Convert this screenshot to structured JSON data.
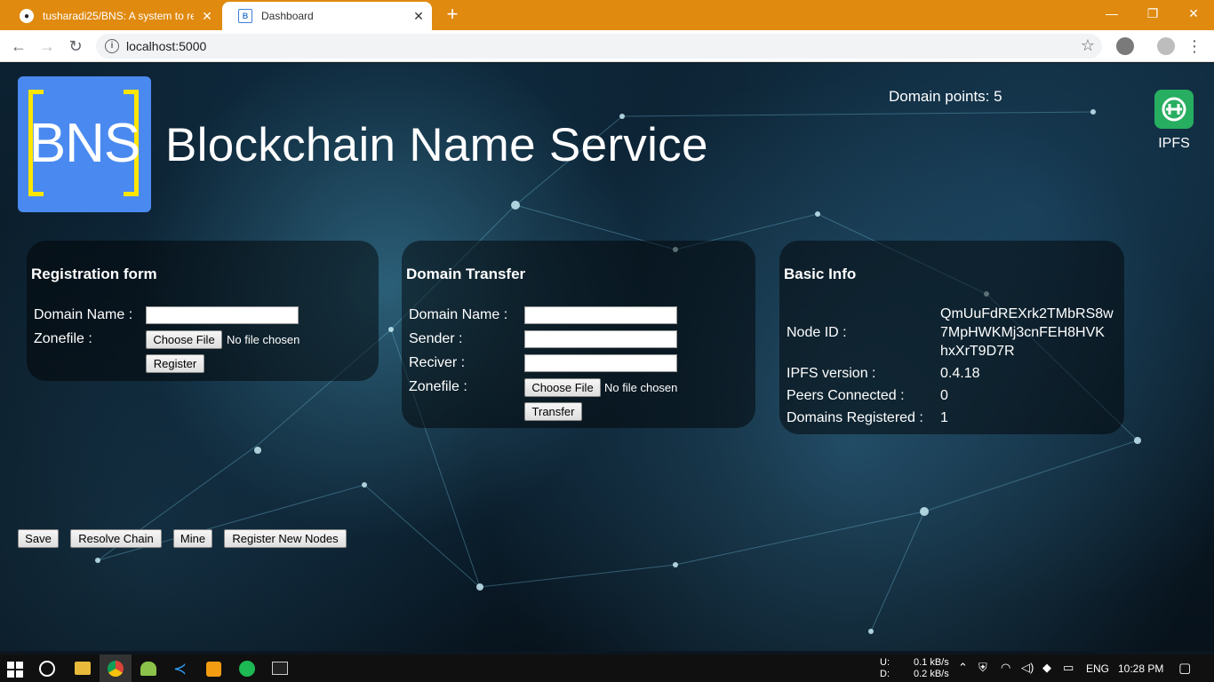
{
  "browser": {
    "tabs": [
      {
        "title": "tusharadi25/BNS: A system to re",
        "active": false
      },
      {
        "title": "Dashboard",
        "active": true
      }
    ],
    "new_tab": "+",
    "url": "localhost:5000",
    "window_controls": {
      "minimize": "—",
      "maximize": "❐",
      "close": "✕"
    }
  },
  "header": {
    "logo_text": "BNS",
    "title": "Blockchain Name Service",
    "domain_points_label": "Domain points:",
    "domain_points_value": "5",
    "ipfs_label": "IPFS"
  },
  "registration": {
    "heading": "Registration form",
    "domain_label": "Domain Name :",
    "domain_value": "",
    "zonefile_label": "Zonefile :",
    "choose_file": "Choose File",
    "no_file": "No file chosen",
    "submit": "Register"
  },
  "transfer": {
    "heading": "Domain Transfer",
    "domain_label": "Domain Name :",
    "sender_label": "Sender :",
    "receiver_label": "Reciver :",
    "zonefile_label": "Zonefile :",
    "choose_file": "Choose File",
    "no_file": "No file chosen",
    "submit": "Transfer"
  },
  "basic_info": {
    "heading": "Basic Info",
    "node_id_label": "Node ID :",
    "node_id_lines": [
      "QmUuFdREXrk2TMbRS8w",
      "7MpHWKMj3cnFEH8HVK",
      "hxXrT9D7R"
    ],
    "ipfs_version_label": "IPFS version :",
    "ipfs_version": "0.4.18",
    "peers_label": "Peers Connected :",
    "peers": "0",
    "domains_label": "Domains Registered :",
    "domains": "1"
  },
  "actions": {
    "save": "Save",
    "resolve": "Resolve Chain",
    "mine": "Mine",
    "register_nodes": "Register New Nodes"
  },
  "taskbar": {
    "upload_label": "U:",
    "upload_rate": "0.1 kB/s",
    "download_label": "D:",
    "download_rate": "0.2 kB/s",
    "language": "ENG",
    "time": "10:28 PM"
  },
  "colors": {
    "titlebar": "#e08a10",
    "logo_bg": "#4a8af0",
    "logo_bracket": "#ffe600",
    "ipfs_icon": "#27ae60"
  }
}
